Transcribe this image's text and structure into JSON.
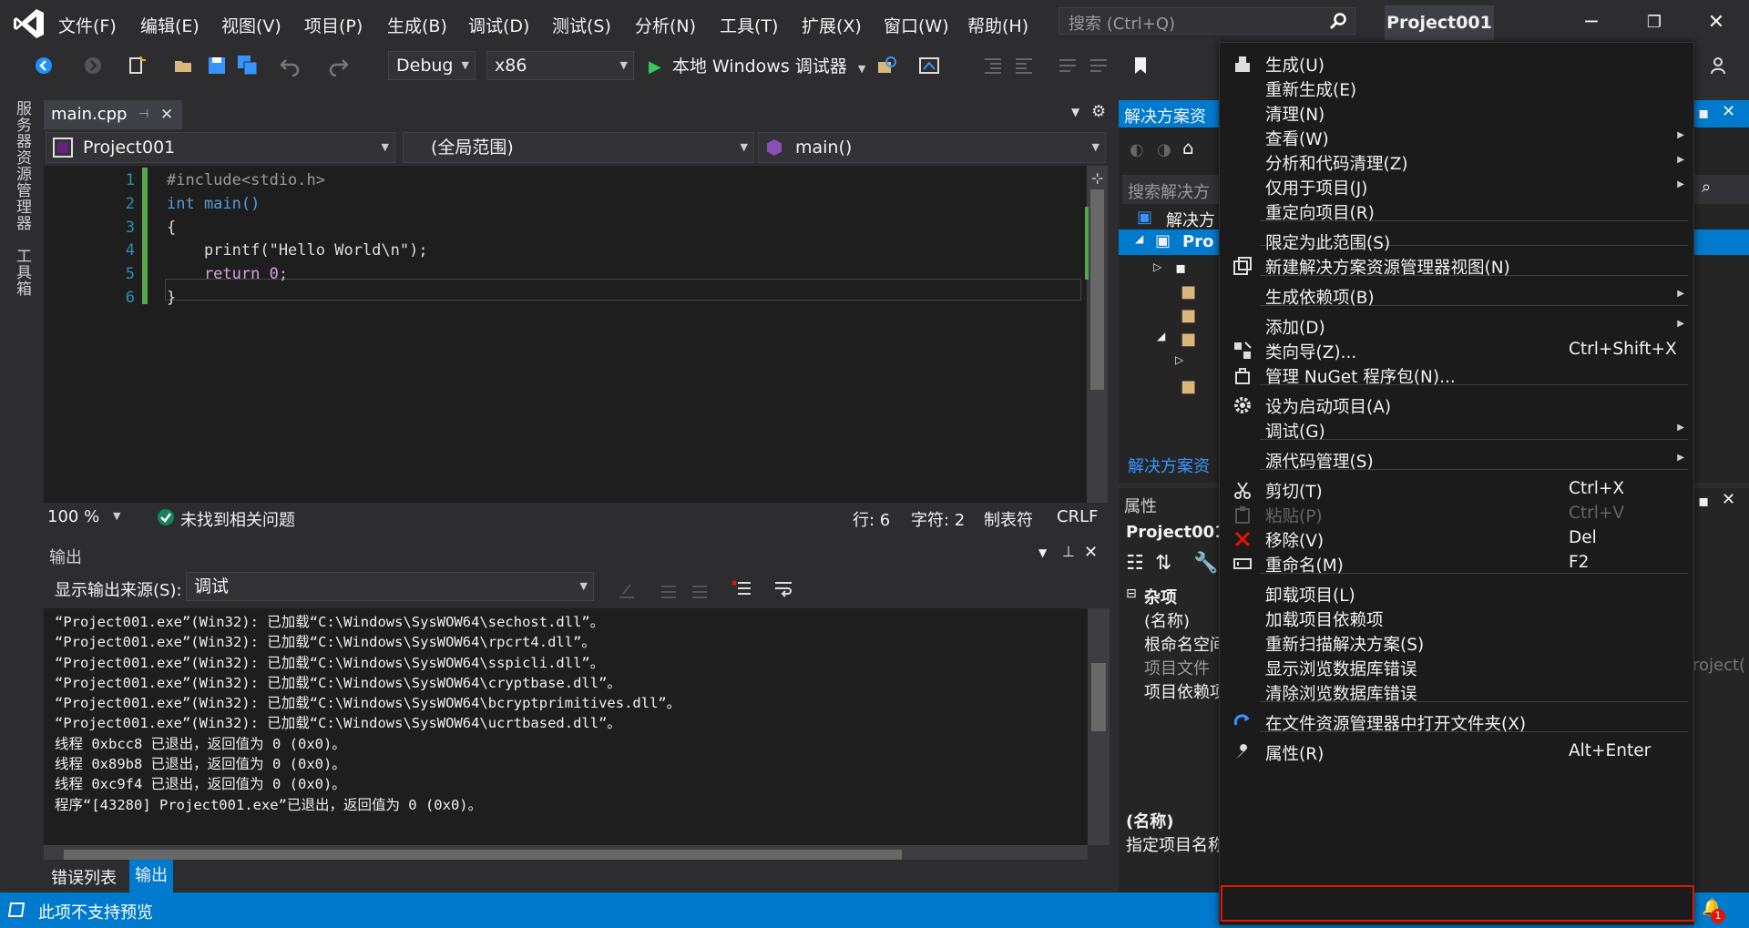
{
  "menubar": {
    "items": [
      "文件(F)",
      "编辑(E)",
      "视图(V)",
      "项目(P)",
      "生成(B)",
      "调试(D)",
      "测试(S)",
      "分析(N)",
      "工具(T)",
      "扩展(X)",
      "窗口(W)",
      "帮助(H)"
    ],
    "search_placeholder": "搜索 (Ctrl+Q)",
    "project_name": "Project001"
  },
  "toolbar": {
    "config": "Debug",
    "platform": "x86",
    "run_label": "本地 Windows 调试器"
  },
  "side_tabs": [
    "服务器资源管理器",
    "工具箱"
  ],
  "editor": {
    "tab": "main.cpp",
    "nav_project": "Project001",
    "nav_scope": "(全局范围)",
    "nav_member": "main()",
    "lines": [
      {
        "no": "1",
        "text": "#include<stdio.h>"
      },
      {
        "no": "2",
        "text": "int main()"
      },
      {
        "no": "3",
        "text": "{"
      },
      {
        "no": "4",
        "text": "    printf(\"Hello World\\n\");"
      },
      {
        "no": "5",
        "text": "    return 0;"
      },
      {
        "no": "6",
        "text": "}"
      }
    ],
    "status": {
      "zoom": "100 %",
      "issues": "未找到相关问题",
      "line": "行: 6",
      "char": "字符: 2",
      "tabs": "制表符",
      "eol": "CRLF"
    }
  },
  "output": {
    "title": "输出",
    "source_label": "显示输出来源(S):",
    "source_value": "调试",
    "lines": [
      "“Project001.exe”(Win32): 已加载“C:\\Windows\\SysWOW64\\sechost.dll”。",
      "“Project001.exe”(Win32): 已加载“C:\\Windows\\SysWOW64\\rpcrt4.dll”。",
      "“Project001.exe”(Win32): 已加载“C:\\Windows\\SysWOW64\\sspicli.dll”。",
      "“Project001.exe”(Win32): 已加载“C:\\Windows\\SysWOW64\\cryptbase.dll”。",
      "“Project001.exe”(Win32): 已加载“C:\\Windows\\SysWOW64\\bcryptprimitives.dll”。",
      "“Project001.exe”(Win32): 已加载“C:\\Windows\\SysWOW64\\ucrtbased.dll”。",
      "线程 0xbcc8 已退出，返回值为 0 (0x0)。",
      "线程 0x89b8 已退出，返回值为 0 (0x0)。",
      "线程 0xc9f4 已退出，返回值为 0 (0x0)。",
      "程序“[43280] Project001.exe”已退出，返回值为 0 (0x0)。"
    ]
  },
  "bottom_tabs": [
    "错误列表",
    "输出"
  ],
  "statusbar": {
    "text": "此项不支持预览",
    "badge": "1"
  },
  "solution_explorer": {
    "title": "解决方案资",
    "search": "搜索解决方",
    "root": "解决方",
    "project": "Pro",
    "footer_link": "解决方案资"
  },
  "properties": {
    "title": "属性",
    "object": "Project001",
    "category": "杂项",
    "rows": [
      "(名称)",
      "根命名空间",
      "项目文件",
      "项目依赖项"
    ],
    "right_fragment": "roject(",
    "desc_title": "(名称)",
    "desc_text": "指定项目名称"
  },
  "context_menu": {
    "items": [
      {
        "label": "生成(U)",
        "icon": "build-icon"
      },
      {
        "label": "重新生成(E)"
      },
      {
        "label": "清理(N)"
      },
      {
        "label": "查看(W)",
        "submenu": true
      },
      {
        "label": "分析和代码清理(Z)",
        "submenu": true
      },
      {
        "label": "仅用于项目(J)",
        "submenu": true
      },
      {
        "label": "重定向项目(R)"
      },
      {
        "label": "限定为此范围(S)"
      },
      {
        "label": "新建解决方案资源管理器视图(N)",
        "icon": "new-view-icon"
      },
      {
        "label": "生成依赖项(B)",
        "submenu": true
      },
      {
        "label": "添加(D)",
        "submenu": true
      },
      {
        "label": "类向导(Z)...",
        "shortcut": "Ctrl+Shift+X",
        "icon": "class-wizard-icon"
      },
      {
        "label": "管理 NuGet 程序包(N)...",
        "icon": "nuget-icon"
      },
      {
        "label": "设为启动项目(A)",
        "icon": "gear-icon"
      },
      {
        "label": "调试(G)",
        "submenu": true
      },
      {
        "label": "源代码管理(S)",
        "submenu": true
      },
      {
        "label": "剪切(T)",
        "shortcut": "Ctrl+X",
        "icon": "scissors-icon"
      },
      {
        "label": "粘贴(P)",
        "shortcut": "Ctrl+V",
        "icon": "paste-icon",
        "disabled": true
      },
      {
        "label": "移除(V)",
        "shortcut": "Del",
        "icon": "remove-icon"
      },
      {
        "label": "重命名(M)",
        "shortcut": "F2",
        "icon": "rename-icon"
      },
      {
        "label": "卸载项目(L)"
      },
      {
        "label": "加载项目依赖项"
      },
      {
        "label": "重新扫描解决方案(S)"
      },
      {
        "label": "显示浏览数据库错误"
      },
      {
        "label": "清除浏览数据库错误"
      },
      {
        "label": "在文件资源管理器中打开文件夹(X)",
        "icon": "refresh-folder-icon"
      },
      {
        "label": "属性(R)",
        "shortcut": "Alt+Enter",
        "icon": "wrench-icon",
        "highlighted": true
      }
    ]
  },
  "colors": {
    "accent": "#007acc",
    "highlight_border": "#e51400",
    "menu_bg": "#1b1b1c"
  }
}
